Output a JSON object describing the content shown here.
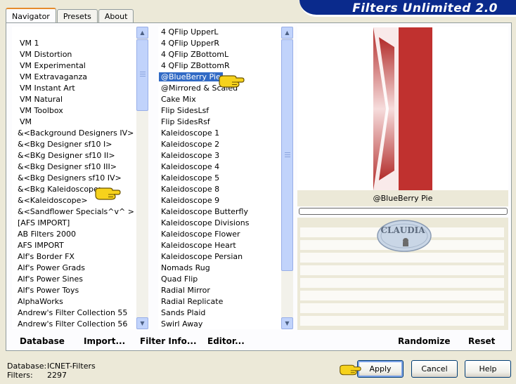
{
  "tabs": [
    {
      "label": "Navigator",
      "active": true
    },
    {
      "label": "Presets",
      "active": false
    },
    {
      "label": "About",
      "active": false
    }
  ],
  "window_title": "Filters Unlimited 2.0",
  "categories": [
    {
      "label": "VM 1",
      "indent": true
    },
    {
      "label": "VM Distortion",
      "indent": true
    },
    {
      "label": "VM Experimental",
      "indent": true
    },
    {
      "label": "VM Extravaganza",
      "indent": true
    },
    {
      "label": "VM Instant Art",
      "indent": true
    },
    {
      "label": "VM Natural",
      "indent": true
    },
    {
      "label": "VM Toolbox",
      "indent": true
    },
    {
      "label": "VM",
      "indent": true
    },
    {
      "label": "&<Background Designers IV>"
    },
    {
      "label": "&<Bkg Designer sf10 I>"
    },
    {
      "label": "&<BKg Designer sf10 II>"
    },
    {
      "label": "&<Bkg Designer sf10 III>"
    },
    {
      "label": "&<Bkg Designers sf10 IV>"
    },
    {
      "label": "&<Bkg Kaleidoscope>"
    },
    {
      "label": "&<Kaleidoscope>"
    },
    {
      "label": "&<Sandflower Specials^v^ >"
    },
    {
      "label": "[AFS IMPORT]"
    },
    {
      "label": "AB Filters 2000"
    },
    {
      "label": "AFS IMPORT"
    },
    {
      "label": "Alf's Border FX"
    },
    {
      "label": "Alf's Power Grads"
    },
    {
      "label": "Alf's Power Sines"
    },
    {
      "label": "Alf's Power Toys"
    },
    {
      "label": "AlphaWorks"
    },
    {
      "label": "Andrew's Filter Collection 55"
    },
    {
      "label": "Andrew's Filter Collection 56"
    }
  ],
  "filters": [
    {
      "label": "4 QFlip UpperL"
    },
    {
      "label": "4 QFlip UpperR"
    },
    {
      "label": "4 QFlip ZBottomL"
    },
    {
      "label": "4 QFlip ZBottomR"
    },
    {
      "label": "@BlueBerry Pie",
      "selected": true
    },
    {
      "label": "@Mirrored & Scaled"
    },
    {
      "label": "Cake Mix"
    },
    {
      "label": "Flip SidesLsf"
    },
    {
      "label": "Flip SidesRsf"
    },
    {
      "label": "Kaleidoscope 1"
    },
    {
      "label": "Kaleidoscope 2"
    },
    {
      "label": "Kaleidoscope 3"
    },
    {
      "label": "Kaleidoscope 4"
    },
    {
      "label": "Kaleidoscope 5"
    },
    {
      "label": "Kaleidoscope 8"
    },
    {
      "label": "Kaleidoscope 9"
    },
    {
      "label": "Kaleidoscope Butterfly"
    },
    {
      "label": "Kaleidoscope Divisions"
    },
    {
      "label": "Kaleidoscope Flower"
    },
    {
      "label": "Kaleidoscope Heart"
    },
    {
      "label": "Kaleidoscope Persian"
    },
    {
      "label": "Nomads Rug"
    },
    {
      "label": "Quad Flip"
    },
    {
      "label": "Radial Mirror"
    },
    {
      "label": "Radial Replicate"
    },
    {
      "label": "Sands Plaid"
    },
    {
      "label": "Swirl Away"
    }
  ],
  "preview": {
    "filter_name": "@BlueBerry Pie",
    "watermark": "CLAUDIA"
  },
  "links": {
    "database": "Database",
    "import": "Import...",
    "filter_info": "Filter Info...",
    "editor": "Editor...",
    "randomize": "Randomize",
    "reset": "Reset"
  },
  "footer": {
    "database_label": "Database:",
    "database_value": "ICNET-Filters",
    "filters_label": "Filters:",
    "filters_value": "2297"
  },
  "buttons": {
    "apply": "Apply",
    "cancel": "Cancel",
    "help": "Help"
  },
  "colors": {
    "title_bar": "#0a2a8c",
    "selection": "#316ac5",
    "preview_red": "#c0312f",
    "pointer_yellow": "#f6d21c"
  },
  "icons": {
    "pointer": "pointing-hand-icon",
    "scroll_up": "arrow-up-icon",
    "scroll_down": "arrow-down-icon"
  }
}
